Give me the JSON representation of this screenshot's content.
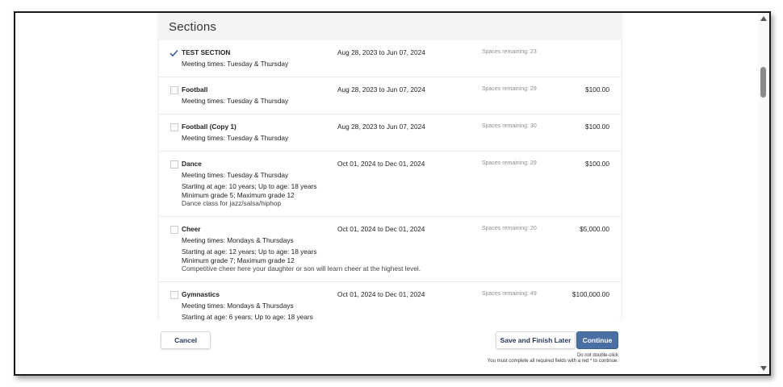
{
  "card": {
    "title": "Sections"
  },
  "sections": [
    {
      "name": "TEST SECTION",
      "checked": true,
      "meeting": "Meeting times: Tuesday & Thursday",
      "dates": "Aug 28, 2023 to Jun 07, 2024",
      "spaces": "Spaces remaining: 23",
      "price": "",
      "extra": []
    },
    {
      "name": "Football",
      "checked": false,
      "meeting": "Meeting times: Tuesday & Thursday",
      "dates": "Aug 28, 2023 to Jun 07, 2024",
      "spaces": "Spaces remaining: 29",
      "price": "$100.00",
      "extra": []
    },
    {
      "name": "Football (Copy 1)",
      "checked": false,
      "meeting": "Meeting times: Tuesday & Thursday",
      "dates": "Aug 28, 2023 to Jun 07, 2024",
      "spaces": "Spaces remaining: 30",
      "price": "$100.00",
      "extra": []
    },
    {
      "name": "Dance",
      "checked": false,
      "meeting": "Meeting times: Tuesday & Thursday",
      "dates": "Oct 01, 2024 to Dec 01, 2024",
      "spaces": "Spaces remaining: 29",
      "price": "$100.00",
      "extra": [
        "Starting at age: 10 years; Up to age: 18 years",
        "Minimum grade 5; Maximum grade 12",
        "Dance class for jazz/salsa/hiphop"
      ]
    },
    {
      "name": "Cheer",
      "checked": false,
      "meeting": "Meeting times: Mondays & Thursdays",
      "dates": "Oct 01, 2024 to Dec 01, 2024",
      "spaces": "Spaces remaining: 20",
      "price": "$5,000.00",
      "extra": [
        "Starting at age: 12 years; Up to age: 18 years",
        "Minimum grade 7; Maximum grade 12",
        "Competitive cheer here your daughter or son will learn cheer at the highest level."
      ]
    },
    {
      "name": "Gymnastics",
      "checked": false,
      "meeting": "Meeting times: Mondays & Thursdays",
      "dates": "Oct 01, 2024 to Dec 01, 2024",
      "spaces": "Spaces remaining: 49",
      "price": "$100,000.00",
      "extra": [
        "Starting at age: 6 years; Up to age: 18 years"
      ]
    }
  ],
  "footer": {
    "cancel_label": "Cancel",
    "save_label": "Save and Finish Later",
    "continue_label": "Continue",
    "note_double_click": "Do not double-click",
    "note_required": "You must complete all required fields with a red * to continue."
  },
  "icons": {
    "check": "checkmark-icon",
    "scroll_up": "scroll-up-arrow-icon",
    "scroll_down": "scroll-down-arrow-icon"
  },
  "colors": {
    "accent": "#4a6fa5",
    "check": "#3b5fa0"
  }
}
